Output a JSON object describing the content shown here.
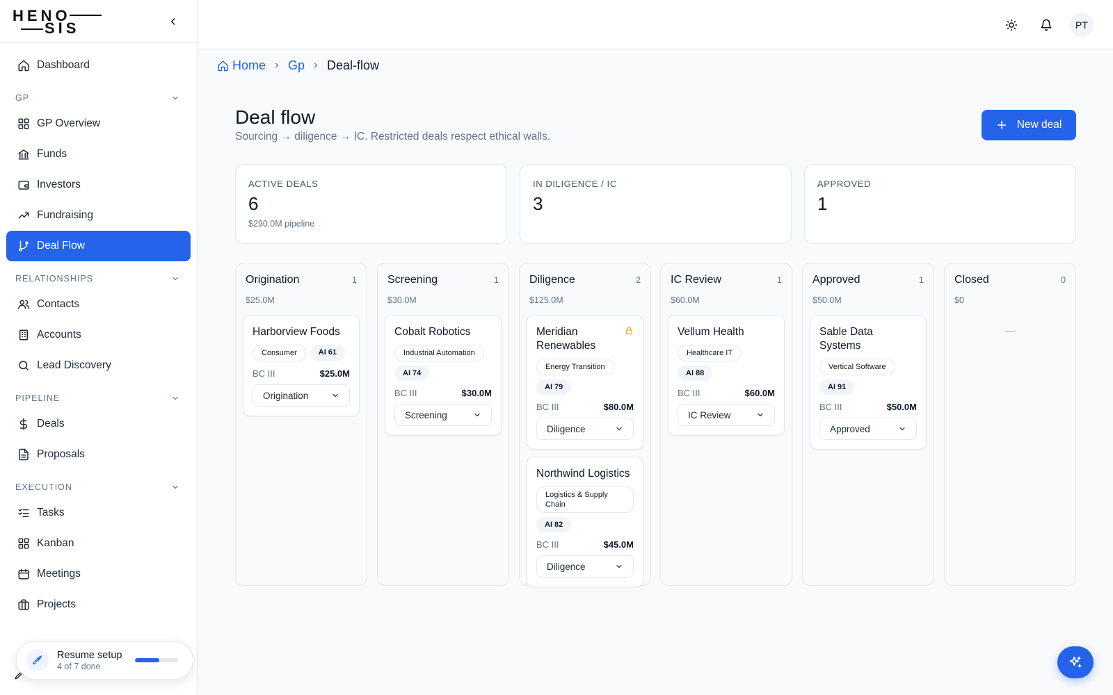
{
  "brand": {
    "logo_top": "HENO",
    "logo_bottom": "SIS"
  },
  "sidebar": {
    "top_items": [
      {
        "label": "Dashboard"
      }
    ],
    "sections": [
      {
        "title": "GP",
        "items": [
          {
            "label": "GP Overview"
          },
          {
            "label": "Funds"
          },
          {
            "label": "Investors"
          },
          {
            "label": "Fundraising"
          },
          {
            "label": "Deal Flow",
            "active": true
          }
        ]
      },
      {
        "title": "RELATIONSHIPS",
        "items": [
          {
            "label": "Contacts"
          },
          {
            "label": "Accounts"
          },
          {
            "label": "Lead Discovery"
          }
        ]
      },
      {
        "title": "PIPELINE",
        "items": [
          {
            "label": "Deals"
          },
          {
            "label": "Proposals"
          }
        ]
      },
      {
        "title": "EXECUTION",
        "items": [
          {
            "label": "Tasks"
          },
          {
            "label": "Kanban"
          },
          {
            "label": "Meetings"
          },
          {
            "label": "Projects"
          }
        ]
      }
    ],
    "setup": {
      "title": "Resume setup",
      "progress_text": "4 of 7 done",
      "progress": 0.57
    }
  },
  "topbar": {
    "avatar_initials": "PT"
  },
  "breadcrumb": {
    "home": "Home",
    "section": "Gp",
    "current": "Deal-flow"
  },
  "page": {
    "title": "Deal flow",
    "subtitle": "Sourcing → diligence → IC. Restricted deals respect ethical walls.",
    "new_deal_label": "New deal"
  },
  "stats": [
    {
      "label": "ACTIVE DEALS",
      "value": "6",
      "sub": "$290.0M pipeline"
    },
    {
      "label": "IN DILIGENCE / IC",
      "value": "3",
      "sub": ""
    },
    {
      "label": "APPROVED",
      "value": "1",
      "sub": ""
    }
  ],
  "columns": [
    {
      "title": "Origination",
      "count": "1",
      "total": "$25.0M",
      "cards": [
        {
          "name": "Harborview Foods",
          "tags": [
            "Consumer"
          ],
          "ai": "AI 61",
          "bc": "BC III",
          "amount": "$25.0M",
          "stage": "Origination",
          "restricted": false
        }
      ]
    },
    {
      "title": "Screening",
      "count": "1",
      "total": "$30.0M",
      "cards": [
        {
          "name": "Cobalt Robotics",
          "tags": [
            "Industrial Automation"
          ],
          "ai": "AI 74",
          "bc": "BC III",
          "amount": "$30.0M",
          "stage": "Screening",
          "restricted": false
        }
      ]
    },
    {
      "title": "Diligence",
      "count": "2",
      "total": "$125.0M",
      "cards": [
        {
          "name": "Meridian Renewables",
          "tags": [
            "Energy Transition"
          ],
          "ai": "AI 79",
          "bc": "BC III",
          "amount": "$80.0M",
          "stage": "Diligence",
          "restricted": true
        },
        {
          "name": "Northwind Logistics",
          "tags": [
            "Logistics & Supply Chain"
          ],
          "ai": "AI 82",
          "bc": "BC III",
          "amount": "$45.0M",
          "stage": "Diligence",
          "restricted": false
        }
      ]
    },
    {
      "title": "IC Review",
      "count": "1",
      "total": "$60.0M",
      "cards": [
        {
          "name": "Vellum Health",
          "tags": [
            "Healthcare IT"
          ],
          "ai": "AI 88",
          "bc": "BC III",
          "amount": "$60.0M",
          "stage": "IC Review",
          "restricted": false
        }
      ]
    },
    {
      "title": "Approved",
      "count": "1",
      "total": "$50.0M",
      "cards": [
        {
          "name": "Sable Data Systems",
          "tags": [
            "Vertical Software"
          ],
          "ai": "AI 91",
          "bc": "BC III",
          "amount": "$50.0M",
          "stage": "Approved",
          "restricted": false
        }
      ]
    },
    {
      "title": "Closed",
      "count": "0",
      "total": "$0",
      "cards": [],
      "empty_text": "—"
    }
  ],
  "colors": {
    "accent": "#2563eb",
    "lock": "#f59e0b"
  }
}
